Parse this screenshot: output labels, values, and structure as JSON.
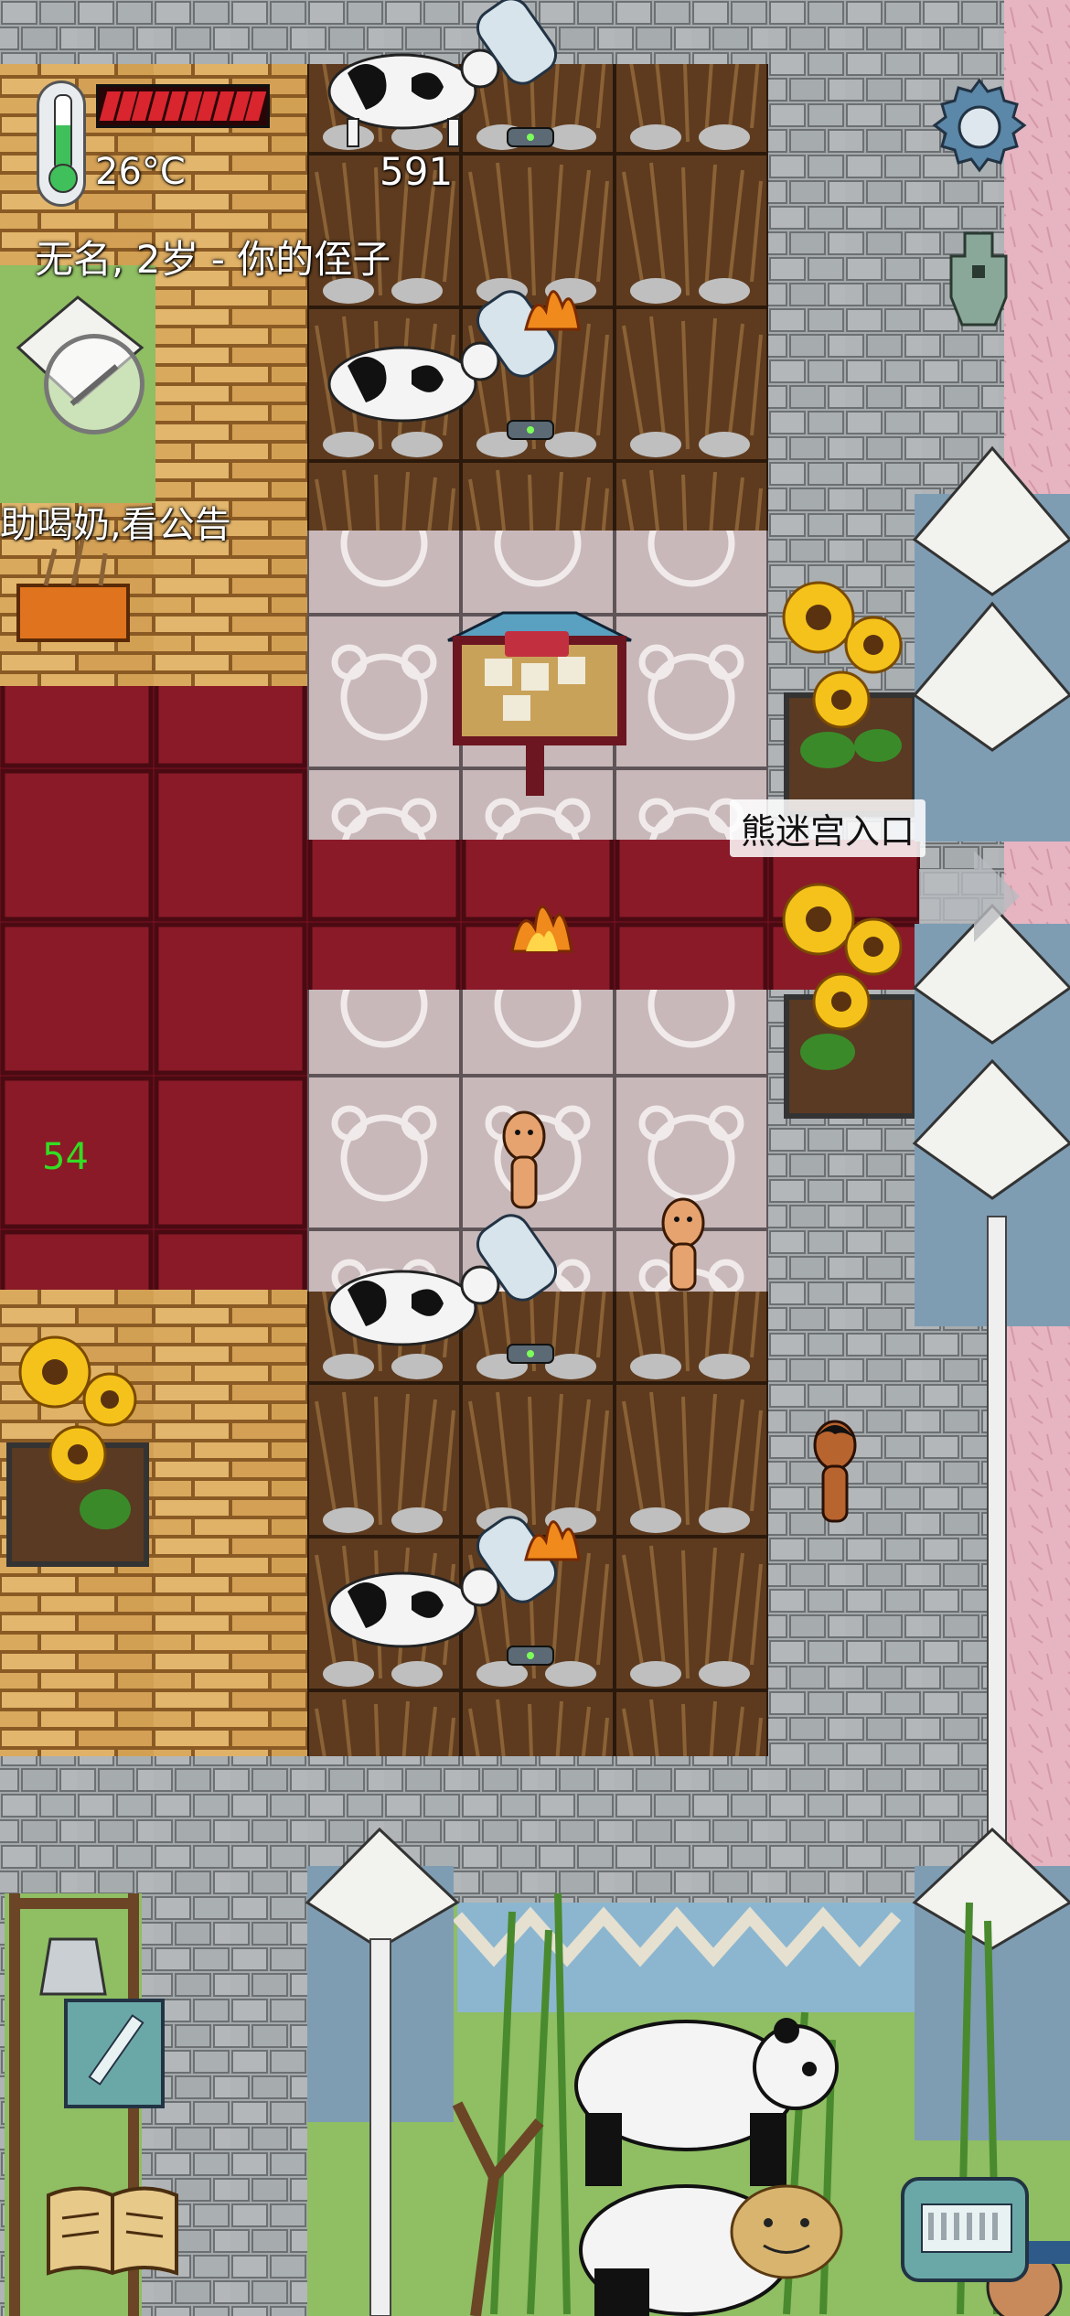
{
  "hud": {
    "temperature": "26°C",
    "food_segments_total": 10,
    "food_segments_filled": 10,
    "year_counter": "591",
    "player_status": "无名, 2岁 - 你的侄子",
    "hint": "助喝奶,看公告",
    "debug_number": "54"
  },
  "signs": {
    "maze_entrance": "熊迷宫入口"
  },
  "icons": {
    "settings": "gear-icon",
    "tech": "ancient-coin-icon",
    "no_talk": "no-speech-icon",
    "note": "pencil-icon",
    "recipes": "book-icon",
    "keyboard": "keyboard-icon"
  },
  "colors": {
    "carpet_red": "#7e1422",
    "wood_floor": "#d9a85a",
    "stone_floor": "#9ea3a6",
    "bear_tile": "#c9b9bb",
    "fur_rug": "#6b4526",
    "grass": "#8fbe63",
    "pink_wall": "#e7b7c3",
    "food_bar": "#d8252e",
    "debug_green": "#33dd22"
  }
}
